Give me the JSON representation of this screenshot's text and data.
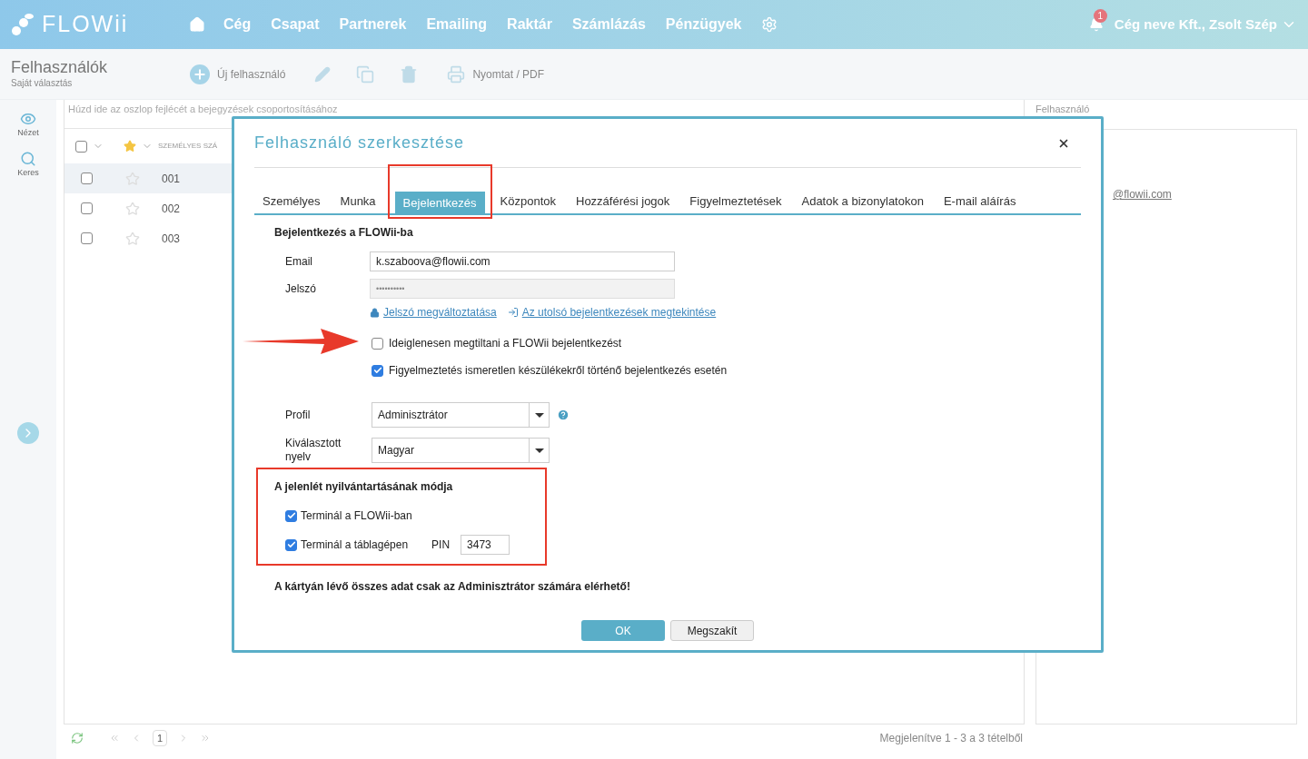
{
  "nav": {
    "logo": "FLOWii",
    "items": [
      "Cég",
      "Csapat",
      "Partnerek",
      "Emailing",
      "Raktár",
      "Számlázás",
      "Pénzügyek"
    ],
    "notifications": "1",
    "user": "Cég neve Kft., Zsolt Szép"
  },
  "toolbar": {
    "title": "Felhasználók",
    "subtitle": "Saját választás",
    "new_button": "Új felhasználó",
    "print_button": "Nyomtat / PDF"
  },
  "sidebar": {
    "items": [
      "Nézet",
      "Keres"
    ]
  },
  "grid": {
    "group_hint": "Húzd ide az oszlop fejlécét a bejegyzések csoportosításához",
    "header_checked": false,
    "columns": [
      "SZEMÉLYES SZÁ"
    ],
    "rows": [
      {
        "cells": [
          "001"
        ],
        "selected": true,
        "checked": false,
        "starred": false
      },
      {
        "cells": [
          "002"
        ],
        "selected": false,
        "checked": false,
        "starred": false
      },
      {
        "cells": [
          "003"
        ],
        "selected": false,
        "checked": false,
        "starred": false
      }
    ],
    "page": "1",
    "summary": "Megjelenítve 1 - 3 a 3 tételből"
  },
  "detail_panel": {
    "title": "Felhasználó",
    "link": "@flowii.com"
  },
  "dialog": {
    "title": "Felhasználó szerkesztése",
    "tabs": [
      {
        "label": "Személyes",
        "selected": false,
        "annotated": false
      },
      {
        "label": "Munka",
        "selected": false,
        "annotated": false
      },
      {
        "label": "Bejelentkezés",
        "selected": true,
        "annotated": true
      },
      {
        "label": "Központok",
        "selected": false,
        "annotated": false
      },
      {
        "label": "Hozzáférési jogok",
        "selected": false,
        "annotated": false
      },
      {
        "label": "Figyelmeztetések",
        "selected": false,
        "annotated": false
      },
      {
        "label": "Adatok a bizonylatokon",
        "selected": false,
        "annotated": false
      },
      {
        "label": "E-mail aláírás",
        "selected": false,
        "annotated": false
      }
    ],
    "section_title": "Bejelentkezés a FLOWii-ba",
    "email": {
      "label": "Email",
      "value": "k.szaboova@flowii.com"
    },
    "password": {
      "label": "Jelszó",
      "value": "••••••••••",
      "disabled": true
    },
    "links": [
      "Jelszó megváltoztatása",
      "Az utolsó bejelentkezések megtekintése"
    ],
    "options": [
      {
        "label": "Ideiglenesen megtiltani a FLOWii bejelentkezést",
        "checked": false,
        "annotated": true
      },
      {
        "label": "Figyelmeztetés ismeretlen készülékekről történő bejelentkezés esetén",
        "checked": true,
        "annotated": false
      }
    ],
    "profile": {
      "label": "Profil",
      "value": "Adminisztrátor"
    },
    "language": {
      "label": "Kiválasztott nyelv",
      "value": "Magyar"
    },
    "attendance": {
      "title": "A jelenlét nyilvántartásának módja",
      "annotated": true,
      "items": [
        {
          "label": "Terminál a FLOWii-ban",
          "checked": true
        },
        {
          "label": "Terminál a táblagépen",
          "checked": true
        }
      ],
      "pin_label": "PIN",
      "pin_value": "3473"
    },
    "note": "A kártyán lévő összes adat csak az Adminisztrátor számára elérhető!",
    "buttons": [
      {
        "label": "OK",
        "kind": "primary"
      },
      {
        "label": "Megszakít",
        "kind": "secondary"
      }
    ]
  }
}
